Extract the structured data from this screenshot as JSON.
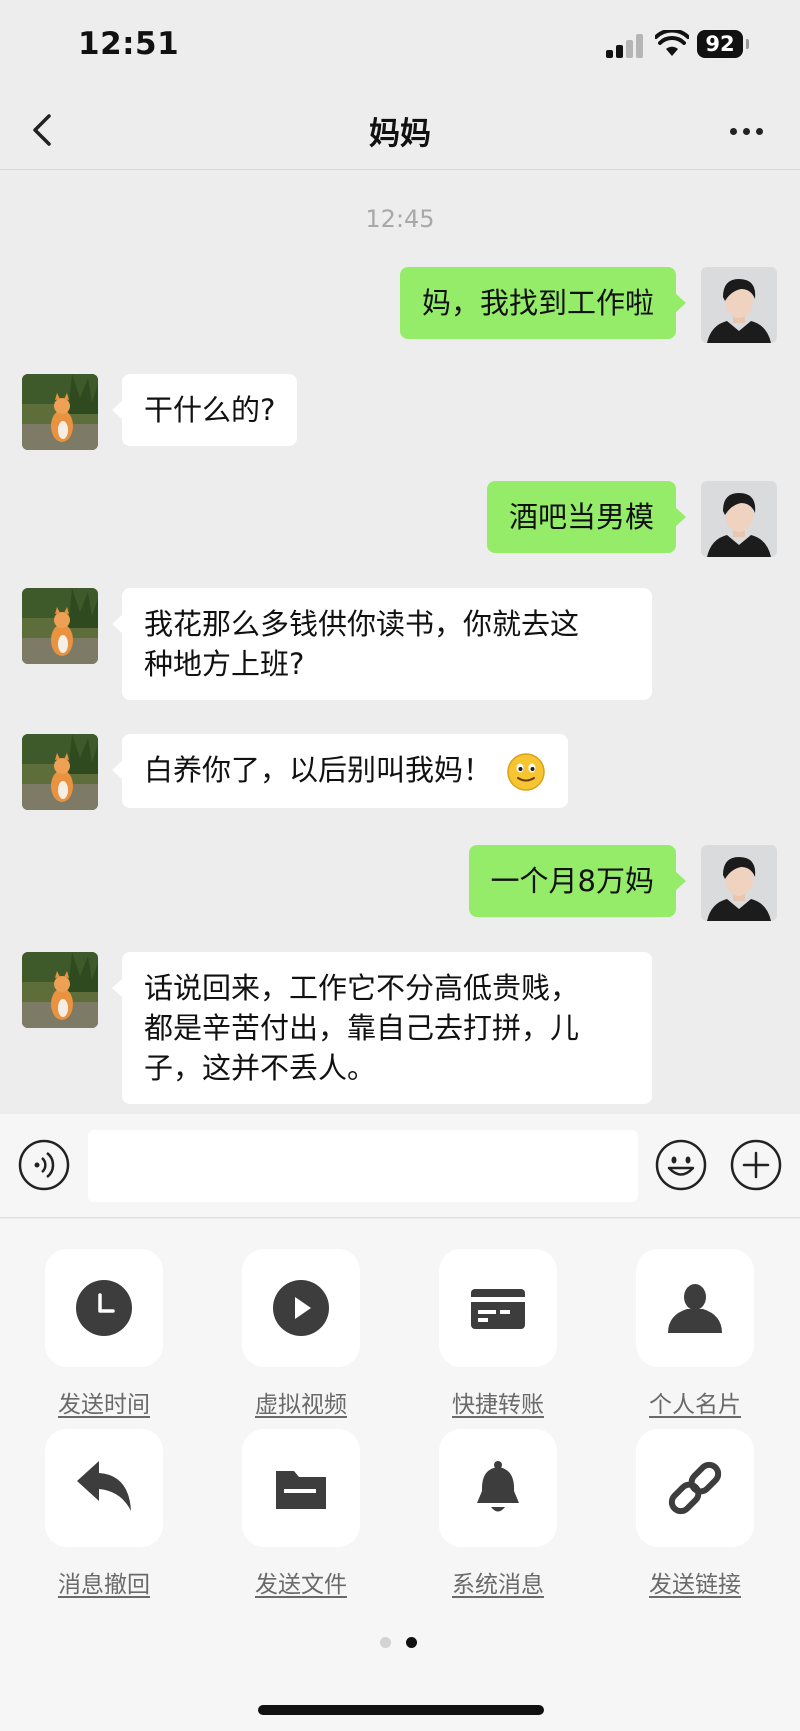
{
  "status_bar": {
    "time": "12:51",
    "battery": "92"
  },
  "nav": {
    "title": "妈妈",
    "back_icon": "chevron-left-icon",
    "more_icon": "more-dots-icon"
  },
  "chat": {
    "timestamp": "12:45",
    "messages": [
      {
        "sender": "me",
        "text": "妈，我找到工作啦"
      },
      {
        "sender": "mom",
        "text": "干什么的?"
      },
      {
        "sender": "me",
        "text": "酒吧当男模"
      },
      {
        "sender": "mom",
        "lines": [
          "我花那么多钱供你读书，你就去这",
          "种地方上班?"
        ]
      },
      {
        "sender": "mom",
        "text": "白养你了，以后别叫我妈！",
        "emoji": "smiling-face-emoji"
      },
      {
        "sender": "me",
        "text": "一个月8万妈"
      },
      {
        "sender": "mom",
        "lines": [
          "话说回来，工作它不分高低贵贱，",
          "都是辛苦付出，靠自己去打拼，儿",
          "子，这并不丢人。"
        ]
      }
    ]
  },
  "input_bar": {
    "value": "",
    "voice_icon": "voice-icon",
    "emoji_icon": "emoji-icon",
    "plus_icon": "plus-icon"
  },
  "tools": [
    {
      "label": "发送时间",
      "icon": "clock-icon"
    },
    {
      "label": "虚拟视频",
      "icon": "play-icon"
    },
    {
      "label": "快捷转账",
      "icon": "card-icon"
    },
    {
      "label": "个人名片",
      "icon": "person-icon"
    },
    {
      "label": "消息撤回",
      "icon": "undo-icon"
    },
    {
      "label": "发送文件",
      "icon": "folder-icon"
    },
    {
      "label": "系统消息",
      "icon": "bell-icon"
    },
    {
      "label": "发送链接",
      "icon": "link-icon"
    }
  ],
  "pager": {
    "pages": 2,
    "active": 2
  },
  "colors": {
    "my_bubble": "#95ec69",
    "their_bubble": "#ffffff",
    "background": "#ededed",
    "panel": "#f6f6f6",
    "icon": "#3d3d3d"
  }
}
